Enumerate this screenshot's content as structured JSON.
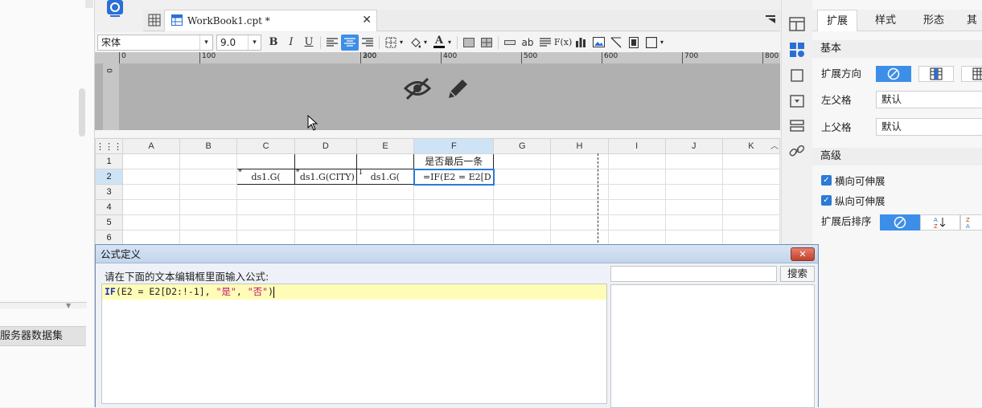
{
  "tab": {
    "filename": "WorkBook1.cpt *"
  },
  "toolbar": {
    "font_name": "宋体",
    "font_size": "9.0",
    "bold": "B",
    "italic": "I",
    "underline": "U",
    "text_ab": "ab",
    "fx": "F(x)",
    "font_color": "A"
  },
  "ruler": {
    "ticks": [
      "0",
      "100",
      "200",
      "300",
      "400",
      "500",
      "600",
      "700",
      "800"
    ],
    "vertical_zero": "0"
  },
  "grid": {
    "columns": [
      "A",
      "B",
      "C",
      "D",
      "E",
      "F",
      "G",
      "H",
      "I",
      "J",
      "K"
    ],
    "rows": [
      "1",
      "2",
      "3",
      "4",
      "5",
      "6"
    ],
    "F1": "是否最后一条",
    "C2": "ds1.G(",
    "D2": "ds1.G(CITY)",
    "E2": "ds1.G(",
    "F2": "=IF(E2 = E2[D"
  },
  "left_pane": {
    "dataset_tab": "服务器数据集"
  },
  "props": {
    "tabs": [
      "扩展",
      "样式",
      "形态",
      "其"
    ],
    "section_basic": "基本",
    "expand_direction": "扩展方向",
    "left_parent": "左父格",
    "left_parent_value": "默认",
    "top_parent": "上父格",
    "top_parent_value": "默认",
    "section_advanced": "高级",
    "h_expandable": "横向可伸展",
    "v_expandable": "纵向可伸展",
    "sort_after_expand": "扩展后排序"
  },
  "dialog": {
    "title": "公式定义",
    "prompt": "请在下面的文本编辑框里面输入公式:",
    "formula": {
      "fn": "IF",
      "part1": "(E2 = E2[D2:!-1], ",
      "s1": "\"是\"",
      "sep": ", ",
      "s2": "\"否\"",
      "end": ")"
    },
    "search_button": "搜索",
    "search_value": ""
  }
}
